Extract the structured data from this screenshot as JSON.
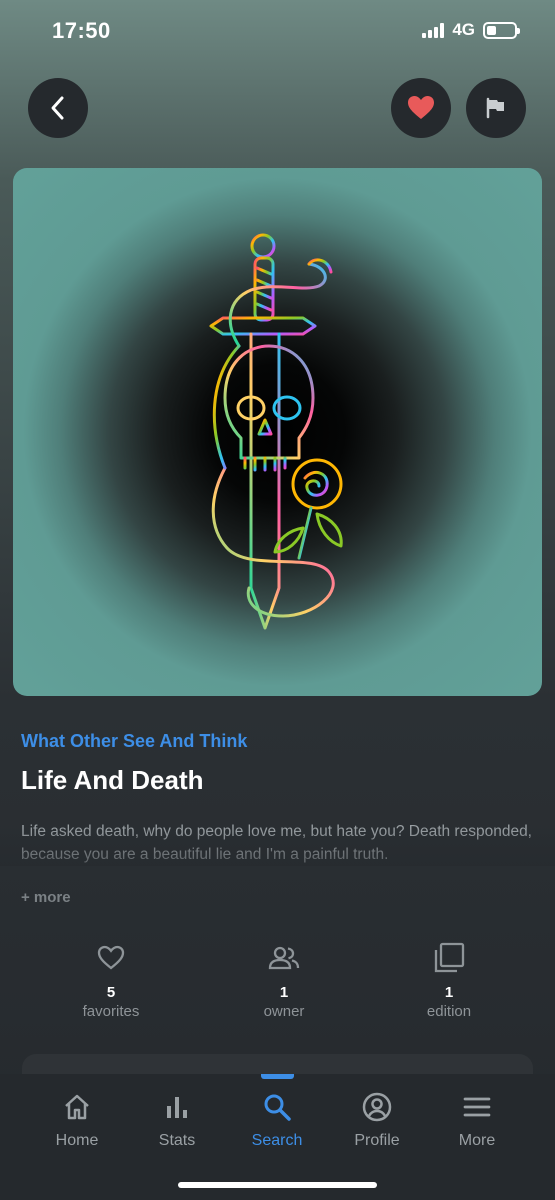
{
  "status_bar": {
    "time": "17:50",
    "network": "4G",
    "battery_level": 0.35
  },
  "header": {
    "back_icon": "chevron-left-icon",
    "favorite_icon": "heart-icon",
    "report_icon": "flag-icon",
    "favorite_color": "#e85a5a"
  },
  "artwork": {
    "description_icon": "skull-dagger-snake-rose-illustration"
  },
  "content": {
    "subtitle": "What Other See And Think",
    "title": "Life And Death",
    "description": "Life asked death, why do people love me, but hate you? Death responded, because you are a beautiful lie and I'm a painful truth.",
    "more_label": "+ more"
  },
  "stats": [
    {
      "icon": "heart-outline-icon",
      "value": "5",
      "label": "favorites"
    },
    {
      "icon": "owners-icon",
      "value": "1",
      "label": "owner"
    },
    {
      "icon": "edition-icon",
      "value": "1",
      "label": "edition"
    }
  ],
  "nav": {
    "active": "Search",
    "accent": "#3d8ee6",
    "items": [
      {
        "icon": "home-icon",
        "label": "Home"
      },
      {
        "icon": "stats-icon",
        "label": "Stats"
      },
      {
        "icon": "search-icon",
        "label": "Search"
      },
      {
        "icon": "profile-icon",
        "label": "Profile"
      },
      {
        "icon": "menu-icon",
        "label": "More"
      }
    ]
  }
}
